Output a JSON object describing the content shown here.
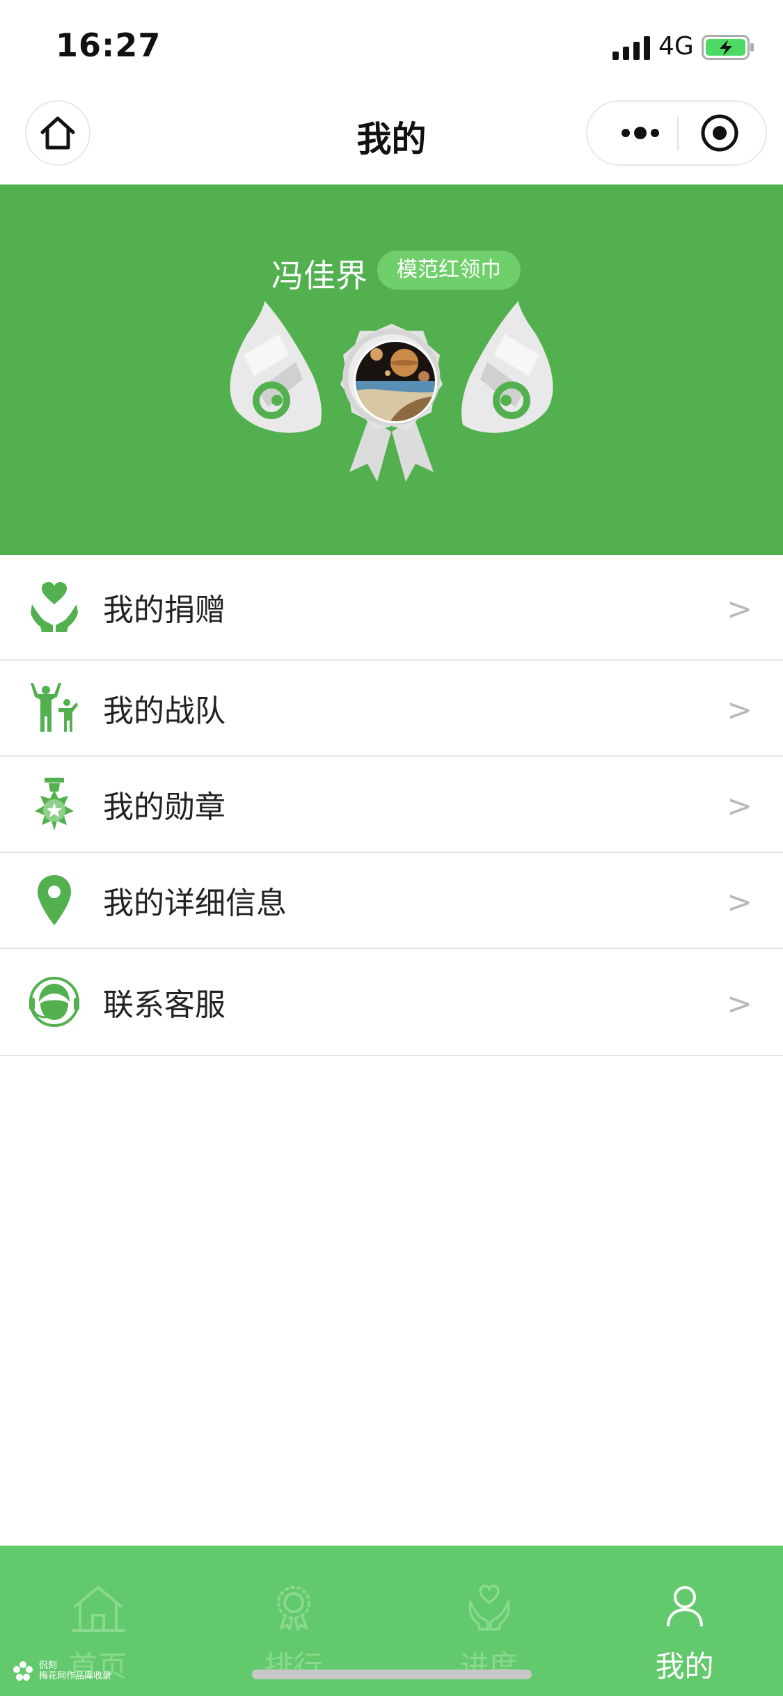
{
  "status_bar": {
    "time": "16:27",
    "network": "4G",
    "battery_color": "#4cd964"
  },
  "nav": {
    "title": "我的"
  },
  "header": {
    "background_color": "#52b04e",
    "user_name": "冯佳界",
    "badge": "模范红领巾"
  },
  "menu": {
    "items": [
      {
        "label": "我的捐赠",
        "icon": "donate-hands-heart-icon",
        "arrow": ">"
      },
      {
        "label": "我的战队",
        "icon": "team-people-icon",
        "arrow": ">"
      },
      {
        "label": "我的勋章",
        "icon": "medal-icon",
        "arrow": ">"
      },
      {
        "label": "我的详细信息",
        "icon": "location-pin-icon",
        "arrow": ">"
      },
      {
        "label": "联系客服",
        "icon": "customer-service-headset-icon",
        "arrow": ">"
      }
    ]
  },
  "tab_bar": {
    "background_color": "#63c96d",
    "tabs": [
      {
        "label": "首页",
        "icon": "home-icon",
        "active": false
      },
      {
        "label": "排行",
        "icon": "ranking-ribbon-icon",
        "active": false
      },
      {
        "label": "进度",
        "icon": "progress-hands-heart-icon",
        "active": false
      },
      {
        "label": "我的",
        "icon": "user-icon",
        "active": true
      }
    ]
  },
  "watermark": {
    "line1": "侃刻",
    "line2": "梅花网作品库收录"
  }
}
